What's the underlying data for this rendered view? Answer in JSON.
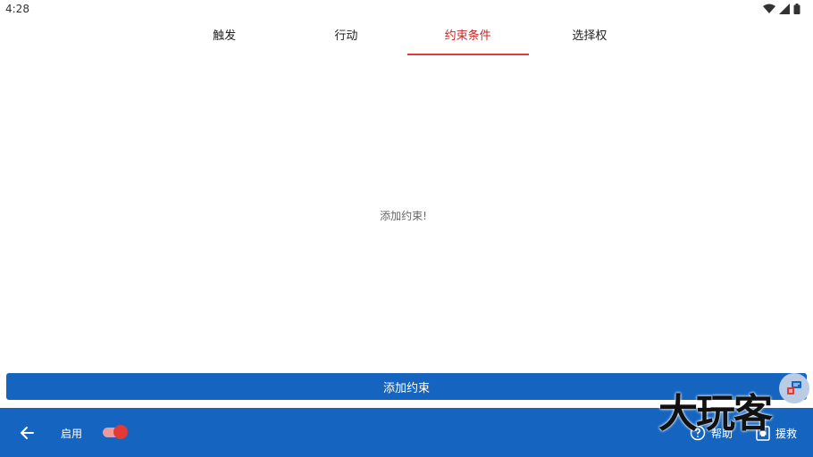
{
  "status": {
    "time": "4:28"
  },
  "tabs": [
    {
      "label": "触发",
      "active": false
    },
    {
      "label": "行动",
      "active": false
    },
    {
      "label": "约束条件",
      "active": true
    },
    {
      "label": "选择权",
      "active": false
    }
  ],
  "main": {
    "empty_message": "添加约束!"
  },
  "add_button": {
    "label": "添加约束"
  },
  "bottom_bar": {
    "enable_label": "启用",
    "toggle_on": true,
    "help_label": "帮助",
    "rescue_label": "援救"
  },
  "watermark": {
    "text": "大玩客"
  },
  "colors": {
    "primary": "#1565c0",
    "accent": "#e53935",
    "active_tab": "#c62828"
  }
}
